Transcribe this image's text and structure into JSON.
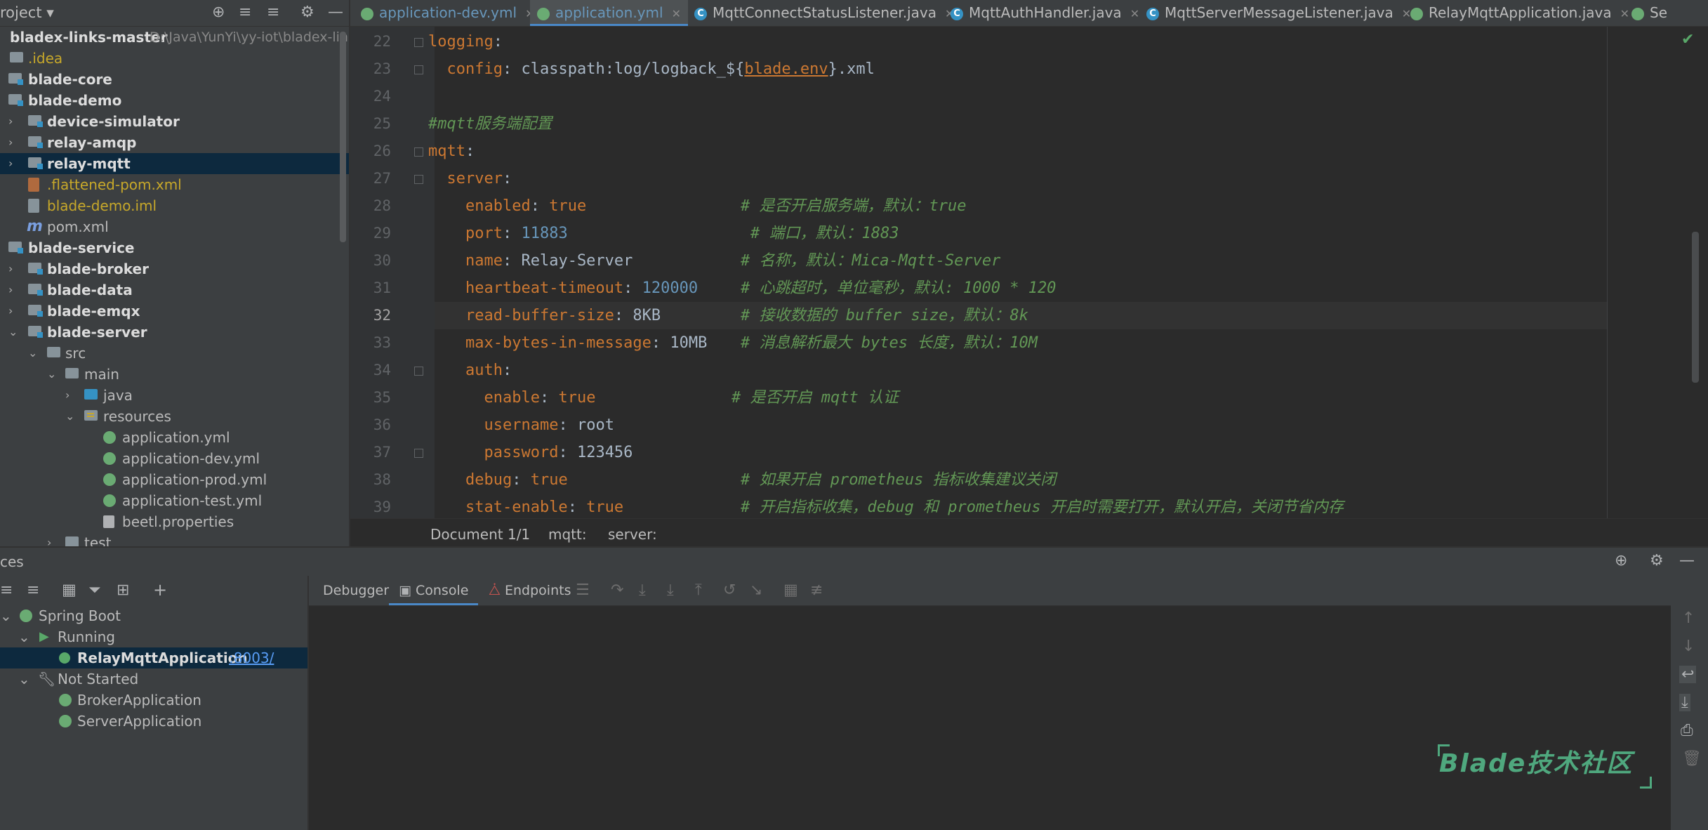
{
  "project_panel": {
    "title": "roject",
    "tree": [
      {
        "label": "bladex-links-master",
        "path": "D:\\Java\\YunYi\\yy-iot\\bladex-lin",
        "bold": true
      },
      {
        "label": ".idea"
      },
      {
        "label": "blade-core"
      },
      {
        "label": "blade-demo"
      },
      {
        "label": "device-simulator"
      },
      {
        "label": "relay-amqp"
      },
      {
        "label": "relay-mqtt"
      },
      {
        "label": ".flattened-pom.xml"
      },
      {
        "label": "blade-demo.iml"
      },
      {
        "label": "pom.xml"
      },
      {
        "label": "blade-service"
      },
      {
        "label": "blade-broker"
      },
      {
        "label": "blade-data"
      },
      {
        "label": "blade-emqx"
      },
      {
        "label": "blade-server"
      },
      {
        "label": "src"
      },
      {
        "label": "main"
      },
      {
        "label": "java"
      },
      {
        "label": "resources"
      },
      {
        "label": "application.yml"
      },
      {
        "label": "application-dev.yml"
      },
      {
        "label": "application-prod.yml"
      },
      {
        "label": "application-test.yml"
      },
      {
        "label": "beetl.properties"
      },
      {
        "label": "test"
      }
    ]
  },
  "tabs": [
    {
      "label": "application-dev.yml"
    },
    {
      "label": "application.yml"
    },
    {
      "label": "MqttConnectStatusListener.java"
    },
    {
      "label": "MqttAuthHandler.java"
    },
    {
      "label": "MqttServerMessageListener.java"
    },
    {
      "label": "RelayMqttApplication.java"
    },
    {
      "label": "Se"
    }
  ],
  "editor": {
    "line_numbers": [
      "22",
      "23",
      "24",
      "25",
      "26",
      "27",
      "28",
      "29",
      "30",
      "31",
      "32",
      "33",
      "34",
      "35",
      "36",
      "37",
      "38",
      "39"
    ],
    "current_line": "32",
    "lines": {
      "l22": {
        "key": "logging",
        "colon": ":"
      },
      "l23": {
        "key": "config",
        "colon": ": ",
        "val1": "classpath:log/logback_${",
        "link": "blade.env",
        "val2": "}.xml"
      },
      "l25": {
        "comment": "#mqtt服务端配置"
      },
      "l26": {
        "key": "mqtt",
        "colon": ":"
      },
      "l27": {
        "key": "server",
        "colon": ":"
      },
      "l28": {
        "key": "enabled",
        "colon": ": ",
        "value": "true",
        "comment": "# 是否开启服务端，默认：true"
      },
      "l29": {
        "key": "port",
        "colon": ": ",
        "value": "11883",
        "comment": "# 端口，默认：1883"
      },
      "l30": {
        "key": "name",
        "colon": ": ",
        "value": "Relay-Server",
        "comment": "# 名称，默认：Mica-Mqtt-Server"
      },
      "l31": {
        "key": "heartbeat-timeout",
        "colon": ": ",
        "value": "120000",
        "comment": "# 心跳超时，单位毫秒，默认: 1000 * 120"
      },
      "l32": {
        "key": "read-buffer-size",
        "colon": ": ",
        "value": "8KB",
        "comment": "# 接收数据的 buffer size，默认：8k"
      },
      "l33": {
        "key": "max-bytes-in-message",
        "colon": ": ",
        "value": "10MB",
        "comment": "# 消息解析最大 bytes 长度，默认：10M"
      },
      "l34": {
        "key": "auth",
        "colon": ":"
      },
      "l35": {
        "key": "enable",
        "colon": ": ",
        "value": "true",
        "comment": "# 是否开启 mqtt 认证"
      },
      "l36": {
        "key": "username",
        "colon": ": ",
        "value": "root"
      },
      "l37": {
        "key": "password",
        "colon": ": ",
        "value": "123456"
      },
      "l38": {
        "key": "debug",
        "colon": ": ",
        "value": "true",
        "comment": "# 如果开启 prometheus 指标收集建议关闭"
      },
      "l39": {
        "key": "stat-enable",
        "colon": ": ",
        "value": "true",
        "comment": "# 开启指标收集，debug 和 prometheus 开启时需要打开，默认开启，关闭节省内存"
      }
    },
    "breadcrumb": {
      "doc": "Document 1/1",
      "crumb1": "mqtt:",
      "crumb2": "server:"
    }
  },
  "services_panel": {
    "title": "ces",
    "console_tabs": [
      {
        "label": "Debugger"
      },
      {
        "label": "Console"
      },
      {
        "label": "Endpoints"
      }
    ],
    "tree": {
      "root": "Spring Boot",
      "running": "Running",
      "running_app": "RelayMqttApplication",
      "running_port": ":8003/",
      "not_started": "Not Started",
      "apps": [
        "BrokerApplication",
        "ServerApplication"
      ]
    }
  },
  "watermark": "Blade技术社区",
  "colors": {
    "accent": "#4a88c7",
    "keyword": "#cc7832",
    "comment": "#629755",
    "number": "#6897bb",
    "selection": "#0d293e"
  }
}
